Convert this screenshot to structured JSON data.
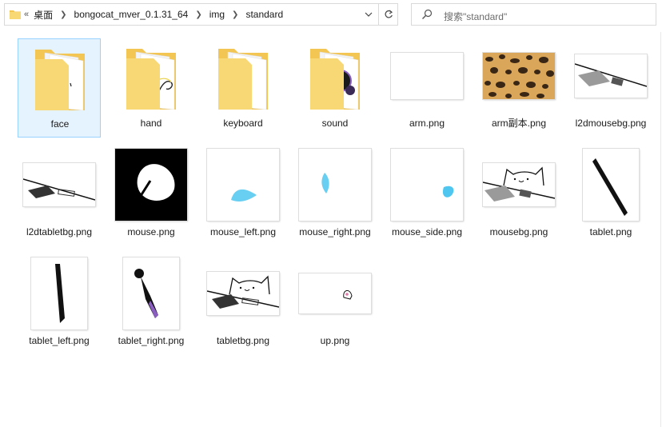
{
  "address_bar": {
    "overflow_symbol": "«",
    "crumbs": [
      "桌面",
      "bongocat_mver_0.1.31_64",
      "img",
      "standard"
    ]
  },
  "search": {
    "placeholder": "搜索\"standard\""
  },
  "items": [
    {
      "label": "face",
      "type": "folder",
      "selected": true
    },
    {
      "label": "hand",
      "type": "folder"
    },
    {
      "label": "keyboard",
      "type": "folder"
    },
    {
      "label": "sound",
      "type": "folder"
    },
    {
      "label": "arm.png",
      "type": "image"
    },
    {
      "label": "arm副本.png",
      "type": "image"
    },
    {
      "label": "l2dmousebg.png",
      "type": "image"
    },
    {
      "label": "l2dtabletbg.png",
      "type": "image"
    },
    {
      "label": "mouse.png",
      "type": "image"
    },
    {
      "label": "mouse_left.png",
      "type": "image"
    },
    {
      "label": "mouse_right.png",
      "type": "image"
    },
    {
      "label": "mouse_side.png",
      "type": "image"
    },
    {
      "label": "mousebg.png",
      "type": "image"
    },
    {
      "label": "tablet.png",
      "type": "image"
    },
    {
      "label": "tablet_left.png",
      "type": "image"
    },
    {
      "label": "tablet_right.png",
      "type": "image"
    },
    {
      "label": "tabletbg.png",
      "type": "image"
    },
    {
      "label": "up.png",
      "type": "image"
    }
  ],
  "colors": {
    "folder": "#f8d775",
    "selection_bg": "#e5f3ff",
    "selection_border": "#99d1ff",
    "blue_mark": "#4ec6f0"
  }
}
